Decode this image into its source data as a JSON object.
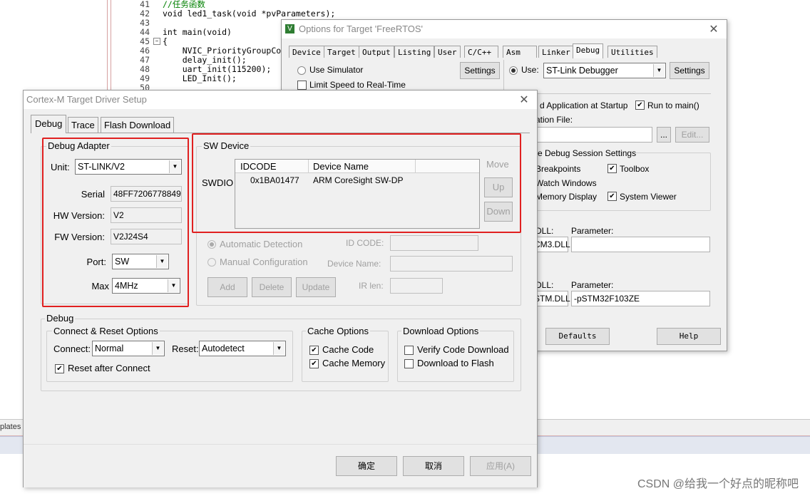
{
  "editor": {
    "lines": [
      {
        "n": "41",
        "code": "//任务函数",
        "type": "comment"
      },
      {
        "n": "42",
        "code": "void led1_task(void *pvParameters);",
        "type": "code"
      },
      {
        "n": "43",
        "code": "",
        "type": "code"
      },
      {
        "n": "44",
        "code": "int main(void)",
        "type": "code"
      },
      {
        "n": "45",
        "code": "{",
        "type": "code"
      },
      {
        "n": "46",
        "code": "    NVIC_PriorityGroupCo",
        "type": "code"
      },
      {
        "n": "47",
        "code": "    delay_init();",
        "type": "code"
      },
      {
        "n": "48",
        "code": "    uart_init(115200);",
        "type": "code"
      },
      {
        "n": "49",
        "code": "    LED_Init();",
        "type": "code"
      },
      {
        "n": "50",
        "code": "",
        "type": "code"
      }
    ],
    "bottom_tab": "plates",
    "watermark": "CSDN @给我一个好点的昵称吧"
  },
  "options_dialog": {
    "title": "Options for Target 'FreeRTOS'",
    "tabs": [
      "Device",
      "Target",
      "Output",
      "Listing",
      "User",
      "C/C++",
      "Asm",
      "Linker",
      "Debug",
      "Utilities"
    ],
    "active_tab": "Debug",
    "use_simulator": "Use Simulator",
    "limit_speed": "Limit Speed to Real-Time",
    "settings_label": "Settings",
    "use_label": "Use:",
    "debugger": "ST-Link Debugger",
    "load_app": "d Application at Startup",
    "run_to_main": "Run to main()",
    "init_file": "ation File:",
    "ellipsis": "...",
    "edit": "Edit...",
    "restore": "re Debug Session Settings",
    "breakpoints": "Breakpoints",
    "toolbox": "Toolbox",
    "watch": "Watch Windows",
    "memory": "Memory Display",
    "system_viewer": "System Viewer",
    "dll1_label": "DLL:",
    "param1_label": "Parameter:",
    "dll1": "CM3.DLL",
    "param1": "",
    "dll2_label": "DLL:",
    "param2_label": "Parameter:",
    "dll2": "STM.DLL",
    "param2": "-pSTM32F103ZE",
    "defaults": "Defaults",
    "help": "Help"
  },
  "driver_dialog": {
    "title": "Cortex-M Target Driver Setup",
    "tabs": [
      "Debug",
      "Trace",
      "Flash Download"
    ],
    "active_tab": "Debug",
    "debug_adapter": {
      "title": "Debug Adapter",
      "unit_label": "Unit:",
      "unit": "ST-LINK/V2",
      "serial_label": "Serial",
      "serial": "48FF7206778849",
      "hw_label": "HW Version:",
      "hw": "V2",
      "fw_label": "FW Version:",
      "fw": "V2J24S4",
      "port_label": "Port:",
      "port": "SW",
      "max_label": "Max",
      "max": "4MHz"
    },
    "sw_device": {
      "title": "SW Device",
      "col_idcode": "IDCODE",
      "col_name": "Device Name",
      "swdio": "SWDIO",
      "rows": [
        {
          "idcode": "0x1BA01477",
          "name": "ARM CoreSight SW-DP"
        }
      ],
      "move": "Move",
      "up": "Up",
      "down": "Down",
      "auto": "Automatic Detection",
      "manual": "Manual Configuration",
      "id_code_label": "ID CODE:",
      "device_name_label": "Device Name:",
      "ir_len_label": "IR len:",
      "add": "Add",
      "delete": "Delete",
      "update": "Update"
    },
    "debug_group": {
      "title": "Debug",
      "connect_reset": {
        "title": "Connect & Reset Options",
        "connect_label": "Connect:",
        "connect": "Normal",
        "reset_label": "Reset:",
        "reset": "Autodetect",
        "reset_after": "Reset after Connect"
      },
      "cache": {
        "title": "Cache Options",
        "code": "Cache Code",
        "memory": "Cache Memory"
      },
      "download": {
        "title": "Download Options",
        "verify": "Verify Code Download",
        "flash": "Download to Flash"
      }
    },
    "ok": "确定",
    "cancel": "取消",
    "apply": "应用(A)"
  }
}
